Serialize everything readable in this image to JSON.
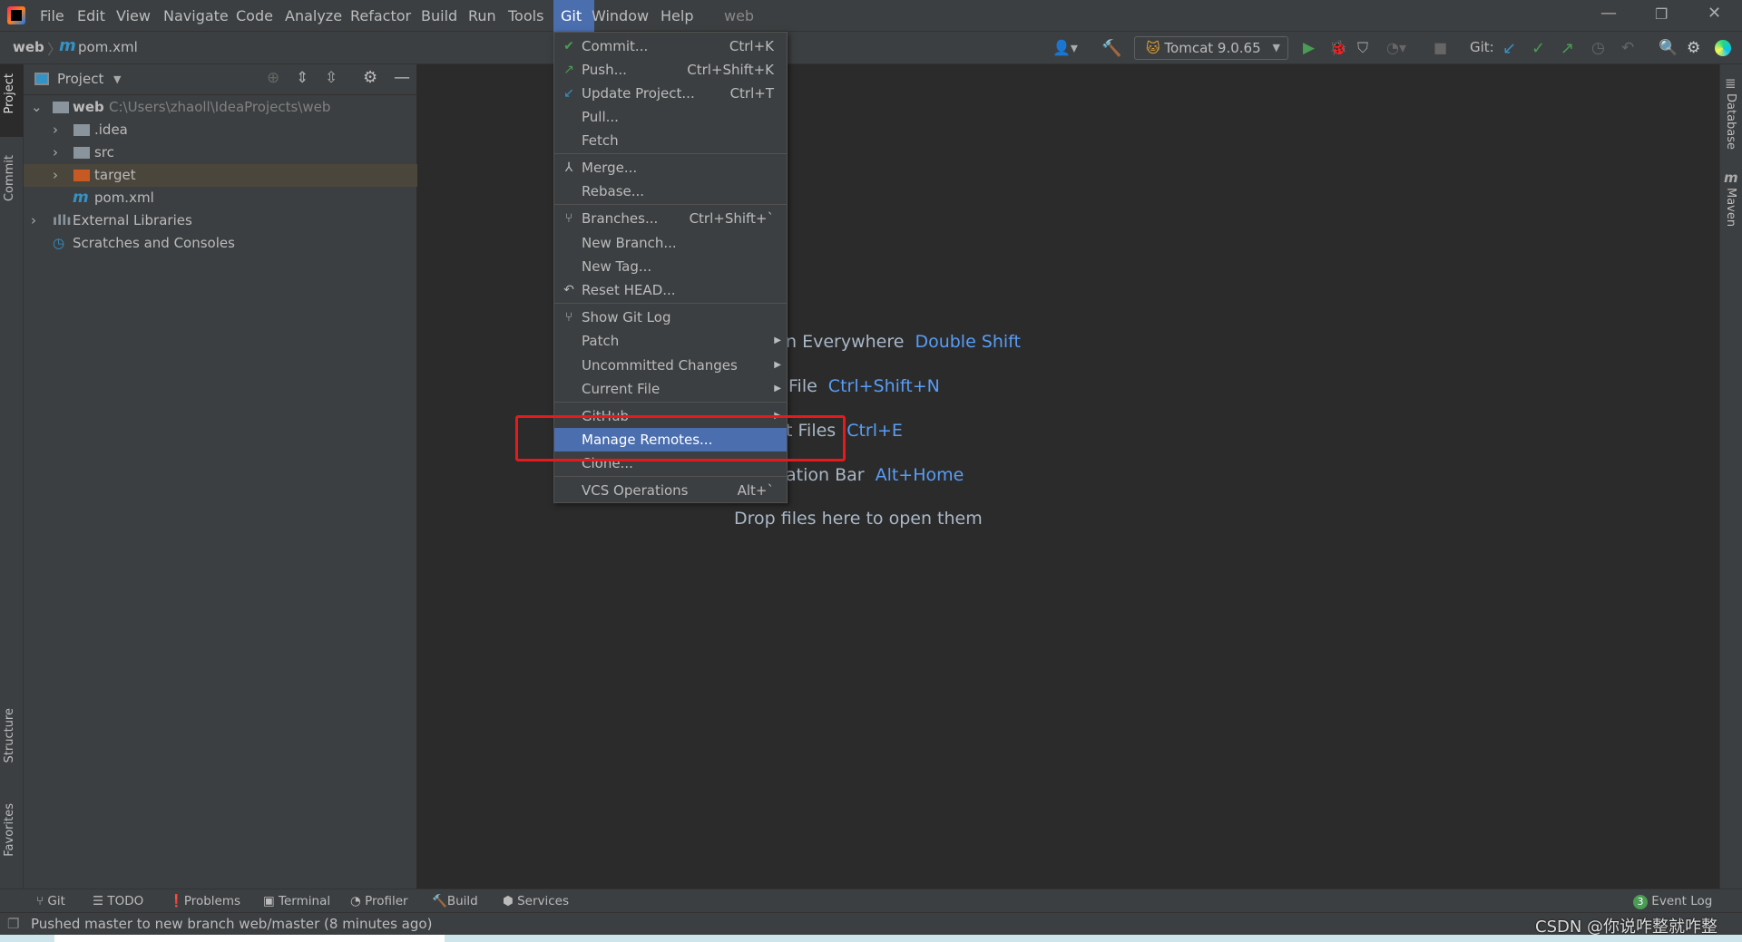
{
  "titlebar": {
    "menu": [
      "File",
      "Edit",
      "View",
      "Navigate",
      "Code",
      "Analyze",
      "Refactor",
      "Build",
      "Run",
      "Tools",
      "Git",
      "Window",
      "Help"
    ],
    "active_menu": "Git",
    "project_name": "web"
  },
  "navbar": {
    "breadcrumb": [
      "web",
      "pom.xml"
    ],
    "run_config": "Tomcat 9.0.65",
    "git_label": "Git:"
  },
  "left_strip": {
    "tabs": [
      "Project",
      "Commit",
      "Structure",
      "Favorites"
    ]
  },
  "right_strip": {
    "tabs": [
      "Database",
      "Maven"
    ]
  },
  "project_panel": {
    "title": "Project",
    "root": {
      "name": "web",
      "path": "C:\\Users\\zhaoll\\IdeaProjects\\web"
    },
    "items": [
      {
        "name": ".idea"
      },
      {
        "name": "src"
      },
      {
        "name": "target"
      },
      {
        "name": "pom.xml"
      },
      {
        "name": "External Libraries"
      },
      {
        "name": "Scratches and Consoles"
      }
    ]
  },
  "git_menu": {
    "items": [
      {
        "label": "Commit...",
        "shortcut": "Ctrl+K",
        "icon": "check-icon"
      },
      {
        "label": "Push...",
        "shortcut": "Ctrl+Shift+K",
        "icon": "push-arrow-icon"
      },
      {
        "label": "Update Project...",
        "shortcut": "Ctrl+T",
        "icon": "update-arrow-icon"
      },
      {
        "label": "Pull...",
        "shortcut": ""
      },
      {
        "label": "Fetch",
        "shortcut": ""
      },
      {
        "label": "Merge...",
        "shortcut": "",
        "icon": "merge-icon"
      },
      {
        "label": "Rebase...",
        "shortcut": ""
      },
      {
        "label": "Branches...",
        "shortcut": "Ctrl+Shift+`",
        "icon": "branch-icon"
      },
      {
        "label": "New Branch...",
        "shortcut": ""
      },
      {
        "label": "New Tag...",
        "shortcut": ""
      },
      {
        "label": "Reset HEAD...",
        "shortcut": "",
        "icon": "undo-icon"
      },
      {
        "label": "Show Git Log",
        "shortcut": "",
        "icon": "git-log-icon"
      },
      {
        "label": "Patch",
        "shortcut": ""
      },
      {
        "label": "Uncommitted Changes",
        "shortcut": ""
      },
      {
        "label": "Current File",
        "shortcut": ""
      },
      {
        "label": "GitHub",
        "shortcut": ""
      },
      {
        "label": "Manage Remotes...",
        "shortcut": ""
      },
      {
        "label": "Clone...",
        "shortcut": ""
      },
      {
        "label": "VCS Operations",
        "shortcut": "Alt+`"
      }
    ],
    "highlighted": "Manage Remotes..."
  },
  "editor": {
    "hints": [
      {
        "text": "n Everywhere",
        "key": "Double Shift"
      },
      {
        "text": "File",
        "key": "Ctrl+Shift+N"
      },
      {
        "text": "t Files",
        "key": "Ctrl+E"
      },
      {
        "text": "ation Bar",
        "key": "Alt+Home"
      }
    ],
    "drop_text": "Drop files here to open them"
  },
  "bottom_tools": [
    "Git",
    "TODO",
    "Problems",
    "Terminal",
    "Profiler",
    "Build",
    "Services"
  ],
  "event_log": {
    "label": "Event Log",
    "count": "3"
  },
  "status": {
    "message": "Pushed master to new branch web/master (8 minutes ago)"
  },
  "watermark": "CSDN @你说咋整就咋整",
  "colors": {
    "accent": "#4b6eaf",
    "link": "#589df6",
    "annotation": "#e8191a",
    "green": "#499c54"
  }
}
